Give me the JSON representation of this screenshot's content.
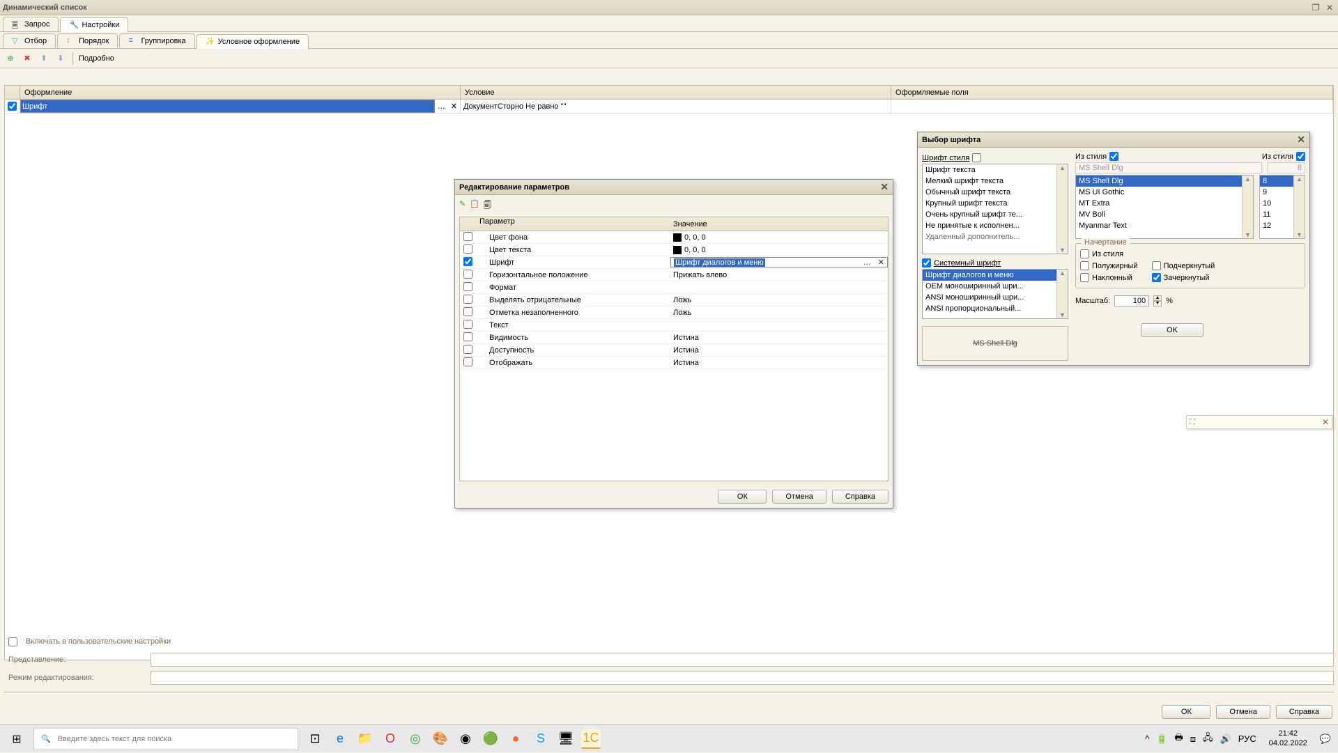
{
  "window": {
    "title": "Динамический список"
  },
  "tabs_main": {
    "query": "Запрос",
    "settings": "Настройки"
  },
  "tabs_sub": {
    "filter": "Отбор",
    "order": "Порядок",
    "group": "Группировка",
    "conditional": "Условное оформление"
  },
  "toolbar": {
    "details": "Подробно"
  },
  "grid_cols": {
    "appearance": "Оформление",
    "condition": "Условие",
    "fields": "Оформляемые поля"
  },
  "grid_row": {
    "appearance": "Шрифт",
    "condition": "ДокументСторно Не равно \"\""
  },
  "include_user": "Включать в пользовательские настройки",
  "labels": {
    "presentation": "Представление:",
    "edit_mode": "Режим редактирования:"
  },
  "main_buttons": {
    "ok": "ОК",
    "cancel": "Отмена",
    "help": "Справка"
  },
  "param_dialog": {
    "title": "Редактирование параметров",
    "cols": {
      "param": "Параметр",
      "value": "Значение"
    },
    "rows": {
      "bg": {
        "name": "Цвет фона",
        "value": "0, 0, 0",
        "swatch": true
      },
      "fg": {
        "name": "Цвет текста",
        "value": "0, 0, 0",
        "swatch": true
      },
      "font": {
        "name": "Шрифт",
        "value": "Шрифт диалогов и меню"
      },
      "hpos": {
        "name": "Горизонтальное положение",
        "value": "Прижать влево"
      },
      "format": {
        "name": "Формат",
        "value": ""
      },
      "neg": {
        "name": "Выделять отрицательные",
        "value": "Ложь"
      },
      "unfilled": {
        "name": "Отметка незаполненного",
        "value": "Ложь"
      },
      "text": {
        "name": "Текст",
        "value": ""
      },
      "vis": {
        "name": "Видимость",
        "value": "Истина"
      },
      "access": {
        "name": "Доступность",
        "value": "Истина"
      },
      "show": {
        "name": "Отображать",
        "value": "Истина"
      }
    },
    "buttons": {
      "ok": "ОК",
      "cancel": "Отмена",
      "help": "Справка"
    }
  },
  "font_dialog": {
    "title": "Выбор шрифта",
    "style_font_label": "Шрифт стиля",
    "from_style": "Из стиля",
    "font_disabled": "MS Shell Dlg",
    "size_disabled": "8",
    "system_font": "Системный шрифт",
    "style_list": [
      "Шрифт текста",
      "Мелкий шрифт текста",
      "Обычный шрифт текста",
      "Крупный шрифт текста",
      "Очень крупный шрифт те...",
      "Не принятые к исполнен...",
      "Удаленный дополнитель..."
    ],
    "system_list": [
      "Шрифт диалогов и меню",
      "OEM моноширинный шри...",
      "ANSI моноширинный шри...",
      "ANSI пропорциональный..."
    ],
    "font_list": [
      "MS Shell Dlg",
      "MS UI Gothic",
      "MT Extra",
      "MV Boli",
      "Myanmar Text"
    ],
    "size_list": [
      "8",
      "9",
      "10",
      "11",
      "12"
    ],
    "selected_font": "MS Shell Dlg",
    "selected_size": "8",
    "selected_system": "Шрифт диалогов и меню",
    "style_group": "Начертание",
    "style_from": "Из стиля",
    "bold": "Полужирный",
    "italic": "Наклонный",
    "underline": "Подчеркнутый",
    "strike": "Зачеркнутый",
    "scale_label": "Масштаб:",
    "scale_value": "100",
    "scale_pct": "%",
    "preview": "MS Shell Dlg",
    "ok": "OK"
  },
  "taskbar": {
    "search_placeholder": "Введите здесь текст для поиска",
    "lang": "РУС",
    "time": "21:42",
    "date": "04.02.2022"
  }
}
